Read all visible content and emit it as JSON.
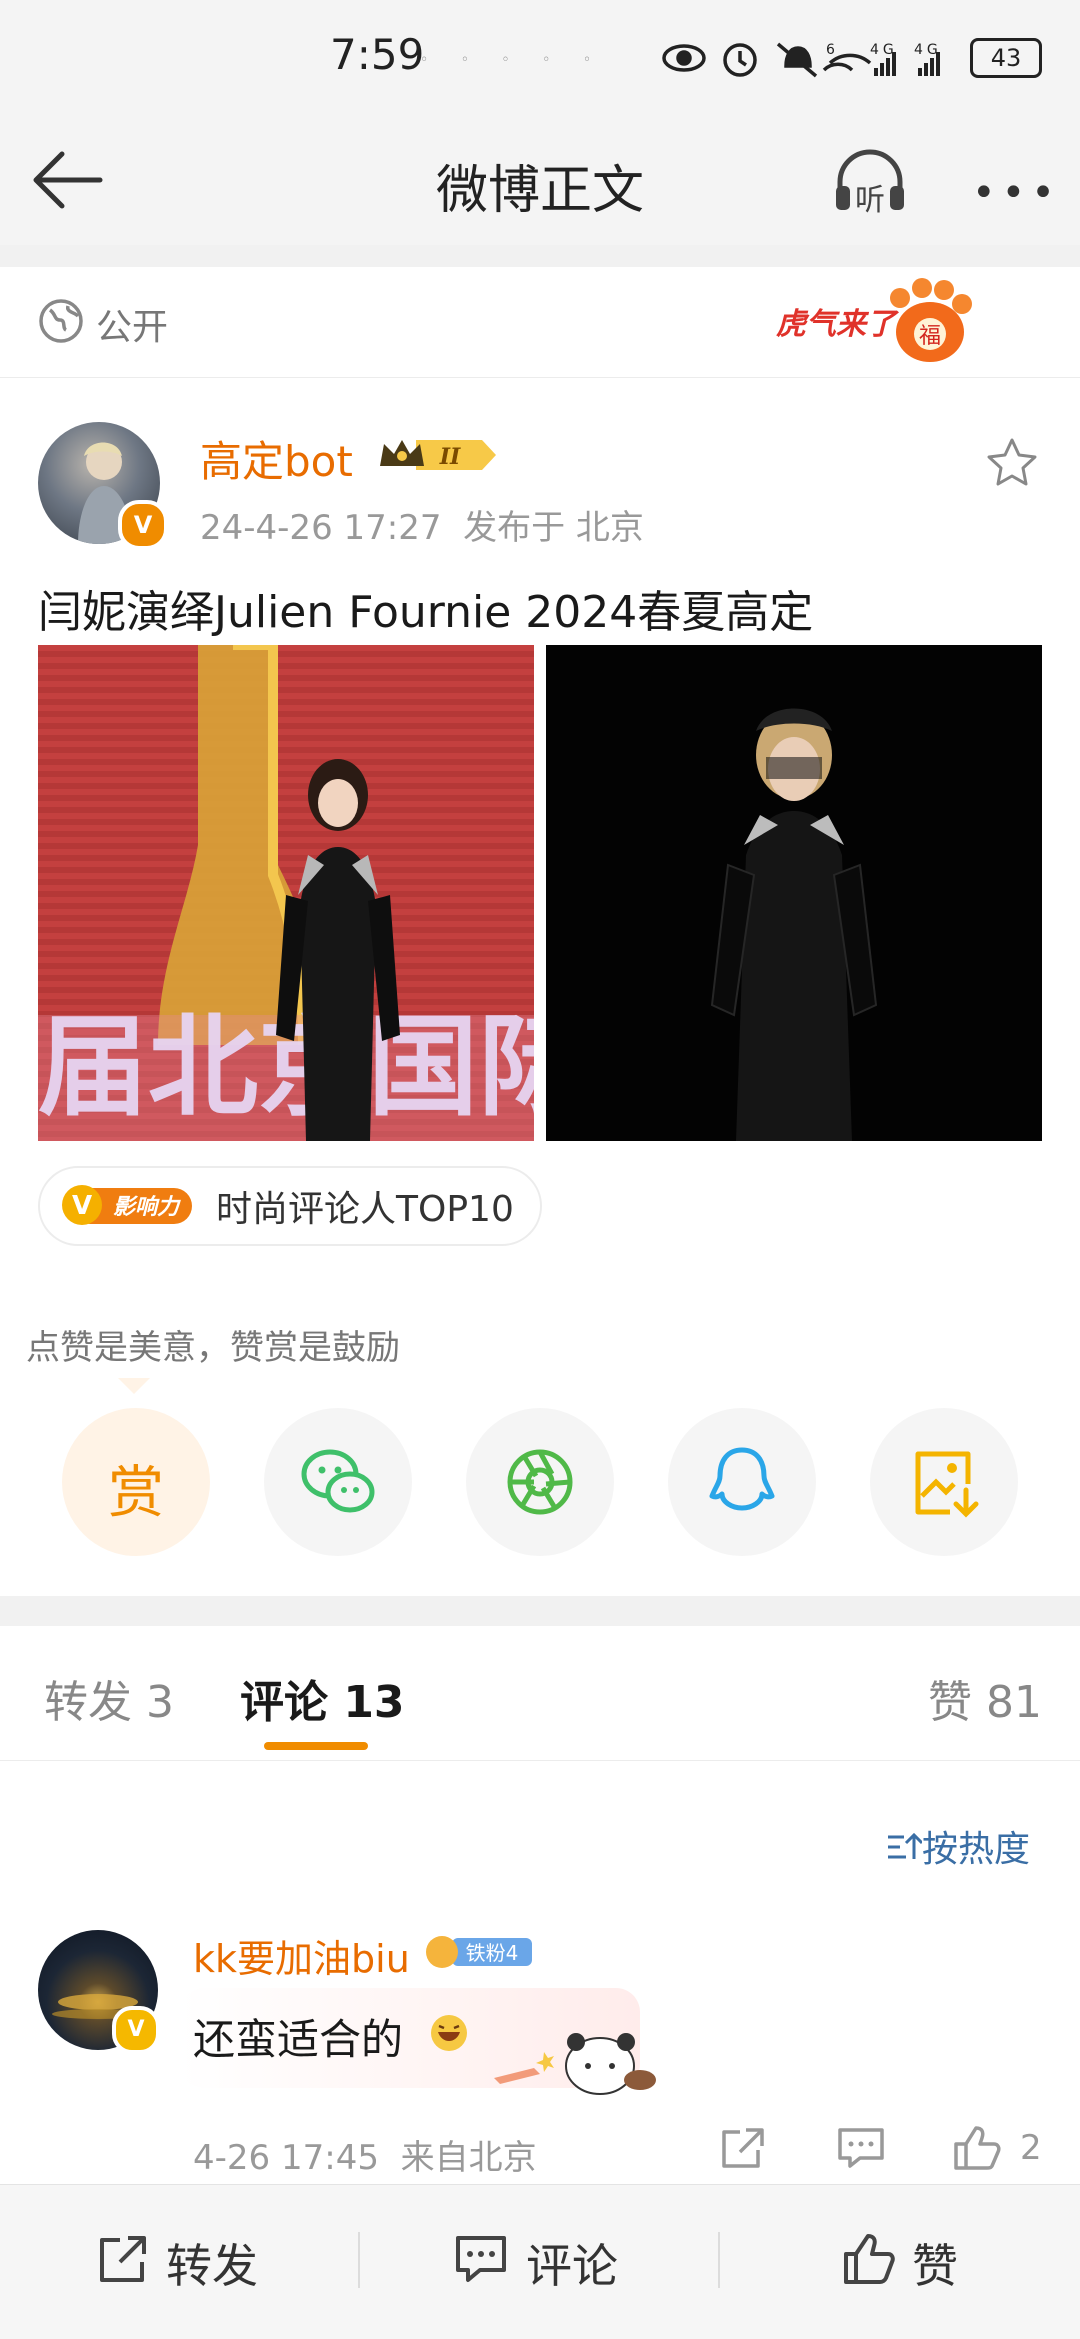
{
  "status_bar": {
    "time": "7:59",
    "battery": "43",
    "icons": [
      "eye-icon",
      "alarm-icon",
      "mute-icon",
      "wifi-icon",
      "signal-4g-icon",
      "signal-4g-icon",
      "battery-icon"
    ]
  },
  "nav": {
    "title": "微博正文",
    "listen_label": "听"
  },
  "visibility": {
    "label": "公开",
    "badge_text": "虎气来了"
  },
  "author": {
    "name": "高定bot",
    "level": "II",
    "verified": "V",
    "date": "24-4-26 17:27",
    "location": "发布于 北京"
  },
  "post": {
    "text": "闫妮演绎Julien Fournie 2024春夏高定",
    "image_caption": "届北京国际"
  },
  "influence": {
    "badge": "影响力",
    "badge_letter": "V",
    "text": "时尚评论人TOP10"
  },
  "reward": {
    "tip": "点赞是美意，赞赏是鼓励",
    "button_label": "赏"
  },
  "share_targets": [
    "wechat-icon",
    "moments-icon",
    "qq-icon",
    "save-image-icon"
  ],
  "tabs": {
    "repost": "转发 3",
    "comment": "评论 13",
    "like": "赞 81",
    "active": "评论 13"
  },
  "sort": {
    "label": "按热度"
  },
  "comment": {
    "author": "kk要加油biu",
    "fan_badge": "铁粉4",
    "text": "还蛮适合的",
    "time": "4-26 17:45",
    "location": "来自北京",
    "likes": "2"
  },
  "bottom_bar": {
    "repost": "转发",
    "comment": "评论",
    "like": "赞"
  },
  "colors": {
    "accent": "#f08c00",
    "name": "#e86c00",
    "link": "#3a6ea5",
    "wechat": "#3fc06a",
    "moments": "#50b948",
    "qq": "#2aa6e8",
    "save": "#f4b400"
  }
}
